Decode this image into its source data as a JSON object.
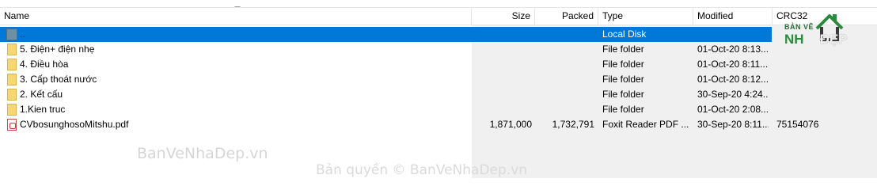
{
  "columns": {
    "name": "Name",
    "size": "Size",
    "packed": "Packed",
    "type": "Type",
    "modified": "Modified",
    "crc": "CRC32"
  },
  "rows": [
    {
      "name": "..",
      "size": "",
      "packed": "",
      "type": "Local Disk",
      "modified": "",
      "crc": "",
      "icon": "folder-up-icon"
    },
    {
      "name": "5. Điện+ điện nhẹ",
      "size": "",
      "packed": "",
      "type": "File folder",
      "modified": "01-Oct-20 8:13...",
      "crc": "",
      "icon": "folder-icon"
    },
    {
      "name": "4. Điều hòa",
      "size": "",
      "packed": "",
      "type": "File folder",
      "modified": "01-Oct-20 8:11...",
      "crc": "",
      "icon": "folder-icon"
    },
    {
      "name": "3. Cấp thoát nước",
      "size": "",
      "packed": "",
      "type": "File folder",
      "modified": "01-Oct-20 8:12...",
      "crc": "",
      "icon": "folder-icon"
    },
    {
      "name": "2. Kết cấu",
      "size": "",
      "packed": "",
      "type": "File folder",
      "modified": "30-Sep-20 4:24...",
      "crc": "",
      "icon": "folder-icon"
    },
    {
      "name": "1.Kien truc",
      "size": "",
      "packed": "",
      "type": "File folder",
      "modified": "01-Oct-20 2:08...",
      "crc": "",
      "icon": "folder-icon"
    },
    {
      "name": "CVbosunghosoMitshu.pdf",
      "size": "1,871,000",
      "packed": "1,732,791",
      "type": "Foxit Reader PDF ...",
      "modified": "30-Sep-20 8:11...",
      "crc": "75154076",
      "icon": "pdf-file-icon"
    }
  ],
  "watermark": {
    "main": "BanVeNhaDep.vn",
    "copyright": "Bản quyền © BanVeNhaDep.vn"
  },
  "logo": {
    "top": "BẢN VẼ",
    "nha": "NH",
    "dep": "ĐẸP"
  },
  "colors": {
    "selection": "#0078d7",
    "folder": "#f7d774",
    "logo_green": "#2b8a3e"
  }
}
